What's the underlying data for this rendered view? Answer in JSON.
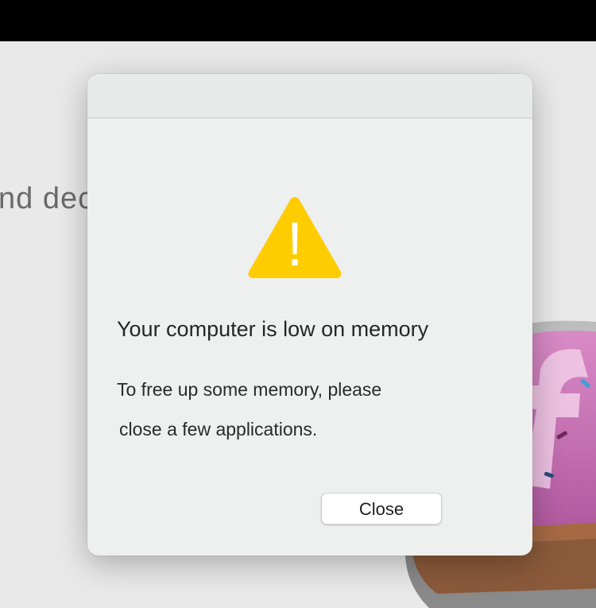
{
  "background": {
    "partial_text": "nd dec"
  },
  "dialog": {
    "icon": "warning-triangle-icon",
    "icon_color": "#FFCC00",
    "title": "Your computer is low on memory",
    "message_line1": "To free up some memory, please",
    "message_line2": "close a few applications.",
    "close_button_label": "Close"
  }
}
